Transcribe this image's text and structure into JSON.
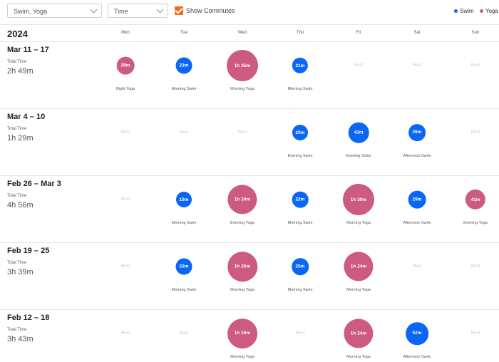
{
  "filters": {
    "sport_select": "Swim, Yoga",
    "metric_select": "Time",
    "show_commutes_label": "Show Commutes",
    "show_commutes_checked": true
  },
  "legend": [
    {
      "label": "Swim",
      "color": "#0a66f5"
    },
    {
      "label": "Yoga",
      "color": "#cc5a83"
    }
  ],
  "year": "2024",
  "days": [
    "Mon",
    "Tue",
    "Wed",
    "Thu",
    "Fri",
    "Sat",
    "Sun"
  ],
  "total_label": "Total Time",
  "rest_label": "Rest",
  "colors": {
    "swim": "#0a66f5",
    "yoga": "#cc5a83"
  },
  "weeks": [
    {
      "title": "Mar 11 – 17",
      "total": "2h 49m",
      "days": [
        {
          "type": "yoga",
          "time": "29m",
          "label": "Night Yoga",
          "minutes": 29
        },
        {
          "type": "swim",
          "time": "23m",
          "label": "Morning Swim",
          "minutes": 23
        },
        {
          "type": "yoga",
          "time": "1h 35m",
          "label": "Morning Yoga",
          "minutes": 95
        },
        {
          "type": "swim",
          "time": "21m",
          "label": "Morning Swim",
          "minutes": 21
        },
        {
          "type": "rest"
        },
        {
          "type": "rest"
        },
        {
          "type": "rest"
        }
      ]
    },
    {
      "title": "Mar 4 – 10",
      "total": "1h 29m",
      "days": [
        {
          "type": "rest"
        },
        {
          "type": "rest"
        },
        {
          "type": "rest"
        },
        {
          "type": "swim",
          "time": "20m",
          "label": "Evening Swim",
          "minutes": 20
        },
        {
          "type": "swim",
          "time": "42m",
          "label": "Evening Swim",
          "minutes": 42
        },
        {
          "type": "swim",
          "time": "26m",
          "label": "Afternoon Swim",
          "minutes": 26
        },
        {
          "type": "rest"
        }
      ]
    },
    {
      "title": "Feb 26 – Mar 3",
      "total": "4h 56m",
      "days": [
        {
          "type": "rest"
        },
        {
          "type": "swim",
          "time": "19m",
          "label": "Morning Swim",
          "minutes": 19
        },
        {
          "type": "yoga",
          "time": "1h 24m",
          "label": "Evening Yoga",
          "minutes": 84
        },
        {
          "type": "swim",
          "time": "22m",
          "label": "Morning Swim",
          "minutes": 22
        },
        {
          "type": "yoga",
          "time": "1h 39m",
          "label": "Morning Yoga",
          "minutes": 99
        },
        {
          "type": "swim",
          "time": "29m",
          "label": "Afternoon Swim",
          "minutes": 29
        },
        {
          "type": "yoga",
          "time": "41m",
          "label": "Evening Yoga",
          "minutes": 41
        }
      ]
    },
    {
      "title": "Feb 19 – 25",
      "total": "3h 39m",
      "days": [
        {
          "type": "rest"
        },
        {
          "type": "swim",
          "time": "23m",
          "label": "Morning Swim",
          "minutes": 23
        },
        {
          "type": "yoga",
          "time": "1h 25m",
          "label": "Morning Yoga",
          "minutes": 85
        },
        {
          "type": "swim",
          "time": "25m",
          "label": "Morning Swim",
          "minutes": 25
        },
        {
          "type": "yoga",
          "time": "1h 24m",
          "label": "Morning Yoga",
          "minutes": 84
        },
        {
          "type": "rest"
        },
        {
          "type": "rest"
        }
      ]
    },
    {
      "title": "Feb 12 – 18",
      "total": "3h 43m",
      "days": [
        {
          "type": "rest"
        },
        {
          "type": "rest"
        },
        {
          "type": "yoga",
          "time": "1h 26m",
          "label": "Morning Yoga",
          "minutes": 86
        },
        {
          "type": "rest"
        },
        {
          "type": "yoga",
          "time": "1h 24m",
          "label": "Morning Yoga",
          "minutes": 84
        },
        {
          "type": "swim",
          "time": "52m",
          "label": "Afternoon Swim",
          "minutes": 52
        },
        {
          "type": "rest"
        }
      ]
    }
  ]
}
